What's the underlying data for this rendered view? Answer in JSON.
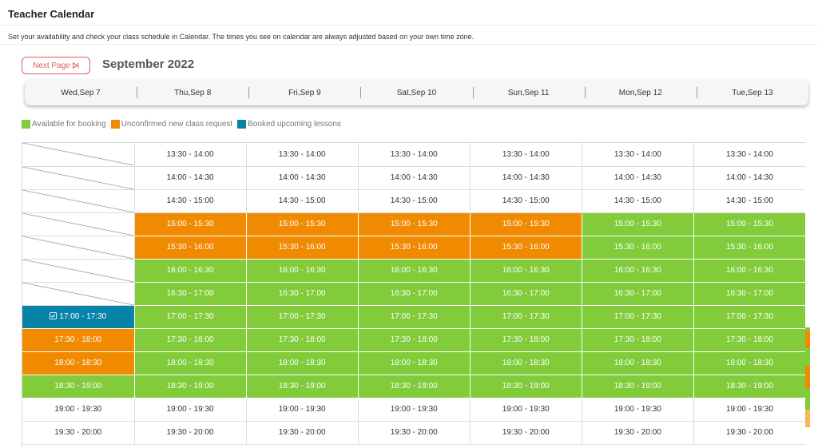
{
  "header": {
    "title": "Teacher Calendar",
    "description": "Set your availability and check your class schedule in Calendar. The times you see on calendar are always adjusted based on your own time zone."
  },
  "toolbar": {
    "next_label": "Next Page",
    "next_icon": "skip-next-icon",
    "month": "September 2022"
  },
  "days": [
    "Wed,Sep 7",
    "Thu,Sep 8",
    "Fri,Sep 9",
    "Sat,Sep 10",
    "Sun,Sep 11",
    "Mon,Sep 12",
    "Tue,Sep 13"
  ],
  "legend": [
    {
      "label": "Available for booking",
      "color": "#82cb3a"
    },
    {
      "label": "Unconfirmed new class request",
      "color": "#f08a00"
    },
    {
      "label": "Booked upcoming lessons",
      "color": "#0683a8"
    }
  ],
  "status_colors": {
    "available": "#82cb3a",
    "pending": "#f08a00",
    "booked": "#0683a8",
    "blank": "#ffffff"
  },
  "grid": {
    "rows": [
      {
        "time": "13:30 - 14:00",
        "cells": [
          "past",
          "blank",
          "blank",
          "blank",
          "blank",
          "blank",
          "blank"
        ]
      },
      {
        "time": "14:00 - 14:30",
        "cells": [
          "past",
          "blank",
          "blank",
          "blank",
          "blank",
          "blank",
          "blank"
        ]
      },
      {
        "time": "14:30 - 15:00",
        "cells": [
          "past",
          "blank",
          "blank",
          "blank",
          "blank",
          "blank",
          "blank"
        ]
      },
      {
        "time": "15:00 - 15:30",
        "cells": [
          "past",
          "pending",
          "pending",
          "pending",
          "pending",
          "available",
          "available"
        ]
      },
      {
        "time": "15:30 - 16:00",
        "cells": [
          "past",
          "pending",
          "pending",
          "pending",
          "pending",
          "available",
          "available"
        ]
      },
      {
        "time": "16:00 - 16:30",
        "cells": [
          "past",
          "available",
          "available",
          "available",
          "available",
          "available",
          "available"
        ]
      },
      {
        "time": "16:30 - 17:00",
        "cells": [
          "past",
          "available",
          "available",
          "available",
          "available",
          "available",
          "available"
        ]
      },
      {
        "time": "17:00 - 17:30",
        "cells": [
          "booked",
          "available",
          "available",
          "available",
          "available",
          "available",
          "available"
        ]
      },
      {
        "time": "17:30 - 18:00",
        "cells": [
          "pending",
          "available",
          "available",
          "available",
          "available",
          "available",
          "available"
        ]
      },
      {
        "time": "18:00 - 18:30",
        "cells": [
          "pending",
          "available",
          "available",
          "available",
          "available",
          "available",
          "available"
        ]
      },
      {
        "time": "18:30 - 19:00",
        "cells": [
          "available",
          "available",
          "available",
          "available",
          "available",
          "available",
          "available"
        ]
      },
      {
        "time": "19:00 - 19:30",
        "cells": [
          "blank",
          "blank",
          "blank",
          "blank",
          "blank",
          "blank",
          "blank"
        ]
      },
      {
        "time": "19:30 - 20:00",
        "cells": [
          "blank",
          "blank",
          "blank",
          "blank",
          "blank",
          "blank",
          "blank"
        ]
      }
    ],
    "booked_icon": "checkbox-icon"
  }
}
